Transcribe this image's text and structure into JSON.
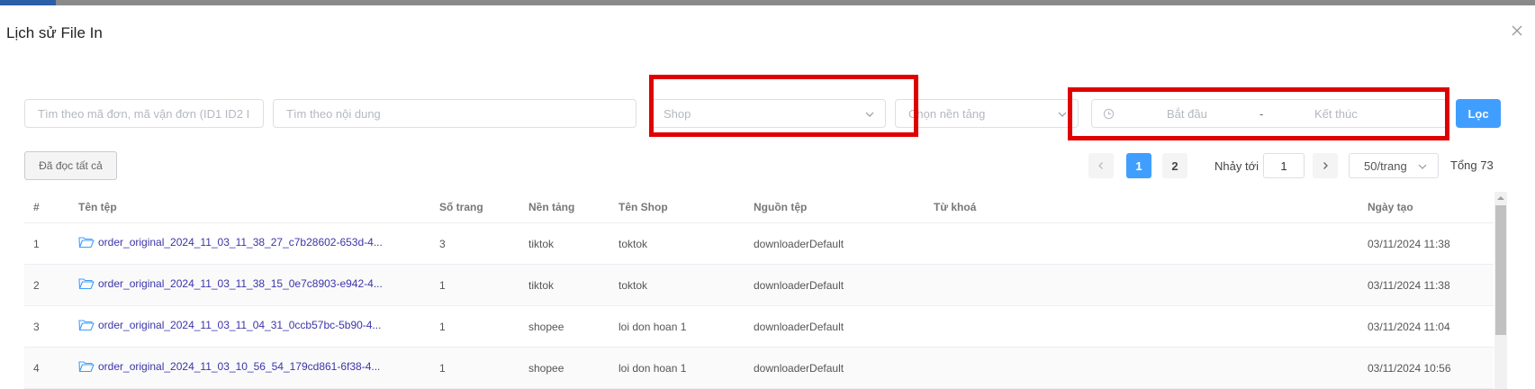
{
  "modal": {
    "title": "Lịch sử File In"
  },
  "filters": {
    "order_search_placeholder": "Tìm theo mã đơn, mã vận đơn (ID1 ID2 I",
    "content_search_placeholder": "Tìm theo nội dung",
    "shop_placeholder": "Shop",
    "platform_placeholder": "Chọn nền tảng",
    "date_start_placeholder": "Bắt đầu",
    "date_separator": "-",
    "date_end_placeholder": "Kết thúc",
    "filter_button": "Lọc"
  },
  "toolbar": {
    "mark_all_read": "Đã đọc tất cả"
  },
  "pagination": {
    "pages": [
      "1",
      "2"
    ],
    "current_page": 1,
    "jump_label": "Nhảy tới",
    "jump_value": "1",
    "page_size": "50/trang",
    "total": "Tổng 73"
  },
  "table": {
    "headers": {
      "index": "#",
      "file_name": "Tên tệp",
      "pages": "Số trang",
      "platform": "Nền tảng",
      "shop": "Tên Shop",
      "source": "Nguồn tệp",
      "keyword": "Từ khoá",
      "created": "Ngày tạo"
    },
    "rows": [
      {
        "index": "1",
        "file_name": "order_original_2024_11_03_11_38_27_c7b28602-653d-4...",
        "pages": "3",
        "platform": "tiktok",
        "shop": "toktok",
        "source": "downloaderDefault",
        "keyword": "",
        "created": "03/11/2024 11:38"
      },
      {
        "index": "2",
        "file_name": "order_original_2024_11_03_11_38_15_0e7c8903-e942-4...",
        "pages": "1",
        "platform": "tiktok",
        "shop": "toktok",
        "source": "downloaderDefault",
        "keyword": "",
        "created": "03/11/2024 11:38"
      },
      {
        "index": "3",
        "file_name": "order_original_2024_11_03_11_04_31_0ccb57bc-5b90-4...",
        "pages": "1",
        "platform": "shopee",
        "shop": "loi don hoan 1",
        "source": "downloaderDefault",
        "keyword": "",
        "created": "03/11/2024 11:04"
      },
      {
        "index": "4",
        "file_name": "order_original_2024_11_03_10_56_54_179cd861-6f38-4...",
        "pages": "1",
        "platform": "shopee",
        "shop": "loi don hoan 1",
        "source": "downloaderDefault",
        "keyword": "",
        "created": "03/11/2024 10:56"
      }
    ]
  },
  "colors": {
    "primary": "#409eff",
    "highlight": "#e00000",
    "link": "#3b35a8"
  },
  "icons": [
    "close-icon",
    "chevron-down-icon",
    "clock-icon",
    "chevron-left-icon",
    "chevron-right-icon",
    "folder-icon"
  ]
}
